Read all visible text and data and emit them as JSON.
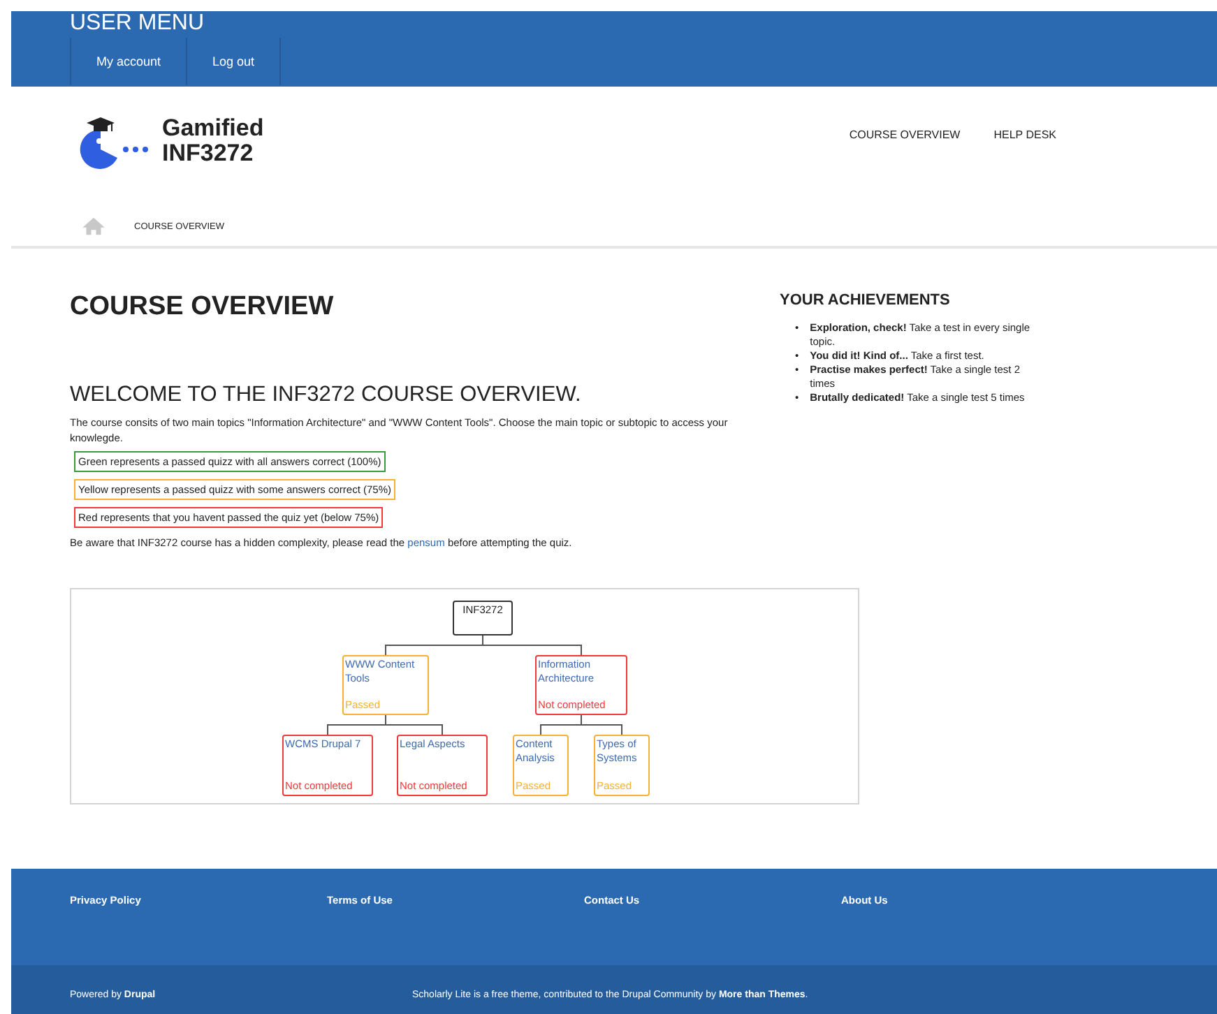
{
  "user_menu": {
    "title": "USER MENU",
    "links": [
      "My account",
      "Log out"
    ]
  },
  "site": {
    "name_lines": [
      "Gamified",
      "INF3272"
    ],
    "nav": [
      "COURSE OVERVIEW",
      "HELP DESK"
    ]
  },
  "breadcrumb": {
    "current": "COURSE OVERVIEW"
  },
  "main": {
    "title": "COURSE OVERVIEW",
    "welcome": "WELCOME TO THE INF3272 COURSE OVERVIEW.",
    "intro": "The course consits of two main topics \"Information Architecture\" and \"WWW Content Tools\". Choose the main topic or subtopic to access your knowlegde.",
    "legend": [
      {
        "text": "Green represents a passed quizz with all answers correct (100%)",
        "color": "#3c9a3c"
      },
      {
        "text": "Yellow represents a passed quizz with some answers correct (75%)",
        "color": "#f5b237"
      },
      {
        "text": "Red represents that you havent passed the quiz yet (below 75%)",
        "color": "#ee3a3a"
      }
    ],
    "notice": {
      "before": "Be aware that INF3272 course has a hidden complexity, please read the ",
      "link": "pensum",
      "after": " before attempting the quiz."
    }
  },
  "tree": {
    "label": "INF3272",
    "children": [
      {
        "label": "WWW Content Tools",
        "color": "#f5b237",
        "status_text": "Passed",
        "children": [
          {
            "label": "WCMS Drupal 7",
            "color": "#ee3a3a",
            "status_text": "Not completed"
          },
          {
            "label": "Legal Aspects",
            "color": "#ee3a3a",
            "status_text": "Not completed"
          }
        ]
      },
      {
        "label": "Information Architecture",
        "color": "#ee3a3a",
        "status_text": "Not completed",
        "children": [
          {
            "label": "Content Analysis",
            "color": "#f5b237",
            "status_text": "Passed"
          },
          {
            "label": "Types of Systems",
            "color": "#f5b237",
            "status_text": "Passed"
          }
        ]
      }
    ]
  },
  "achievements": {
    "title": "YOUR ACHIEVEMENTS",
    "items": [
      {
        "bullet": "•",
        "name": "Exploration, check!",
        "text": "Take a test in every single topic."
      },
      {
        "bullet": "•",
        "name": "You did it! Kind of...",
        "text": "Take a first test."
      },
      {
        "bullet": "•",
        "name": "Practise makes perfect!",
        "text": "Take a single test 2 times"
      },
      {
        "bullet": "•",
        "name": "Brutally dedicated!",
        "text": "Take a single test 5 times"
      }
    ]
  },
  "footer": {
    "links": [
      "Privacy Policy",
      "Terms of Use",
      "Contact Us",
      "About Us"
    ],
    "powered_by": "Powered by **Drupal**",
    "credit": "Scholarly Lite is a free theme, contributed to the Drupal Community by **More than Themes**."
  }
}
